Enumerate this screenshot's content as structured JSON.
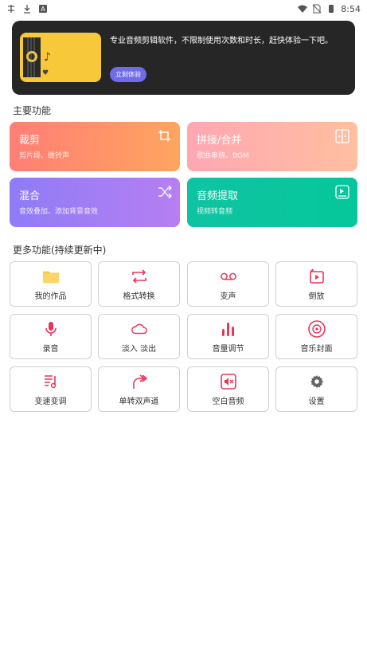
{
  "status_bar": {
    "time": "8:54"
  },
  "banner": {
    "text": "专业音频剪辑软件，不限制使用次数和时长，赶快体验一下吧。",
    "button_label": "立刻体验"
  },
  "main_section": {
    "title": "主要功能",
    "cards": [
      {
        "title": "裁剪",
        "subtitle": "剪片段、做铃声",
        "icon": "crop-icon",
        "color_from": "#ff7e76",
        "color_to": "#ffa55f"
      },
      {
        "title": "拼接/合并",
        "subtitle": "歌曲串烧、BGM",
        "icon": "merge-icon",
        "color_from": "#ffa7b3",
        "color_to": "#ffbfa0"
      },
      {
        "title": "混合",
        "subtitle": "音效叠加、添加背景音效",
        "icon": "shuffle-icon",
        "color_from": "#8f7cf6",
        "color_to": "#b67ff2"
      },
      {
        "title": "音频提取",
        "subtitle": "视频转音频",
        "icon": "video-extract-icon",
        "color_from": "#0fc3a2",
        "color_to": "#05c79b"
      }
    ]
  },
  "more_section": {
    "title": "更多功能(持续更新中)",
    "items": [
      {
        "label": "我的作品",
        "icon": "folder-icon"
      },
      {
        "label": "格式转换",
        "icon": "convert-icon"
      },
      {
        "label": "变声",
        "icon": "voicemail-icon"
      },
      {
        "label": "倒放",
        "icon": "reverse-play-icon"
      },
      {
        "label": "录音",
        "icon": "microphone-icon"
      },
      {
        "label": "淡入 淡出",
        "icon": "cloud-icon"
      },
      {
        "label": "音量调节",
        "icon": "volume-bars-icon"
      },
      {
        "label": "音乐封面",
        "icon": "disc-icon"
      },
      {
        "label": "变速变调",
        "icon": "music-note-lines-icon"
      },
      {
        "label": "单转双声道",
        "icon": "double-arrow-icon"
      },
      {
        "label": "空白音频",
        "icon": "mute-icon"
      },
      {
        "label": "设置",
        "icon": "gear-icon"
      }
    ]
  },
  "colors": {
    "accent": "#e8365a",
    "banner_bg": "#262626",
    "button": "#6f6bea"
  }
}
